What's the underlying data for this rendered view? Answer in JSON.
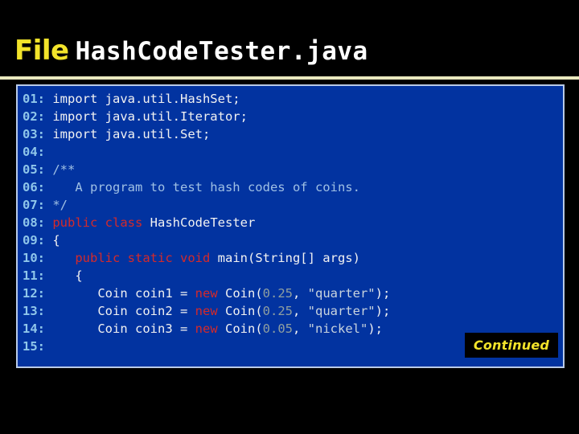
{
  "slide": {
    "title_prefix": "File",
    "title_filename": "HashCodeTester.java",
    "badge_label": "Continued",
    "colors": {
      "background": "#000000",
      "title_accent": "#f2e32a",
      "title_text": "#ffffff",
      "rule": "#e9e8bd",
      "panel_background": "#0233a0",
      "panel_border": "#b9cbe8",
      "line_number": "#8fc6ea",
      "code_plain": "#f2f2f2",
      "code_keyword": "#d42a2a",
      "code_comment": "#9fc0e4",
      "code_string": "#c9d4de",
      "code_number": "#8f9fa0",
      "badge_background": "#000000",
      "badge_text": "#f2e32a"
    }
  },
  "code": {
    "language": "java",
    "lines": [
      {
        "num": "01:",
        "tokens": [
          {
            "t": "import java.util.HashSet;",
            "k": "plain"
          }
        ]
      },
      {
        "num": "02:",
        "tokens": [
          {
            "t": "import java.util.Iterator;",
            "k": "plain"
          }
        ]
      },
      {
        "num": "03:",
        "tokens": [
          {
            "t": "import java.util.Set;",
            "k": "plain"
          }
        ]
      },
      {
        "num": "04:",
        "tokens": [
          {
            "t": "",
            "k": "plain"
          }
        ]
      },
      {
        "num": "05:",
        "tokens": [
          {
            "t": "/**",
            "k": "comment"
          }
        ]
      },
      {
        "num": "06:",
        "tokens": [
          {
            "t": "   A program to test hash codes of coins.",
            "k": "comment"
          }
        ]
      },
      {
        "num": "07:",
        "tokens": [
          {
            "t": "*/",
            "k": "comment"
          }
        ]
      },
      {
        "num": "08:",
        "tokens": [
          {
            "t": "public class ",
            "k": "keyword"
          },
          {
            "t": "HashCodeTester",
            "k": "plain"
          }
        ]
      },
      {
        "num": "09:",
        "tokens": [
          {
            "t": "{",
            "k": "plain"
          }
        ]
      },
      {
        "num": "10:",
        "tokens": [
          {
            "t": "   ",
            "k": "plain"
          },
          {
            "t": "public static void ",
            "k": "keyword"
          },
          {
            "t": "main(String[] args)",
            "k": "plain"
          }
        ]
      },
      {
        "num": "11:",
        "tokens": [
          {
            "t": "   {",
            "k": "plain"
          }
        ]
      },
      {
        "num": "12:",
        "tokens": [
          {
            "t": "      Coin coin1 = ",
            "k": "plain"
          },
          {
            "t": "new",
            "k": "keyword"
          },
          {
            "t": " Coin(",
            "k": "plain"
          },
          {
            "t": "0.25",
            "k": "number"
          },
          {
            "t": ", ",
            "k": "plain"
          },
          {
            "t": "\"quarter\"",
            "k": "string"
          },
          {
            "t": ");",
            "k": "plain"
          }
        ]
      },
      {
        "num": "13:",
        "tokens": [
          {
            "t": "      Coin coin2 = ",
            "k": "plain"
          },
          {
            "t": "new",
            "k": "keyword"
          },
          {
            "t": " Coin(",
            "k": "plain"
          },
          {
            "t": "0.25",
            "k": "number"
          },
          {
            "t": ", ",
            "k": "plain"
          },
          {
            "t": "\"quarter\"",
            "k": "string"
          },
          {
            "t": ");",
            "k": "plain"
          }
        ]
      },
      {
        "num": "14:",
        "tokens": [
          {
            "t": "      Coin coin3 = ",
            "k": "plain"
          },
          {
            "t": "new",
            "k": "keyword"
          },
          {
            "t": " Coin(",
            "k": "plain"
          },
          {
            "t": "0.05",
            "k": "number"
          },
          {
            "t": ", ",
            "k": "plain"
          },
          {
            "t": "\"nickel\"",
            "k": "string"
          },
          {
            "t": ");",
            "k": "plain"
          }
        ]
      },
      {
        "num": "15:",
        "tokens": [
          {
            "t": "",
            "k": "plain"
          }
        ]
      }
    ]
  }
}
